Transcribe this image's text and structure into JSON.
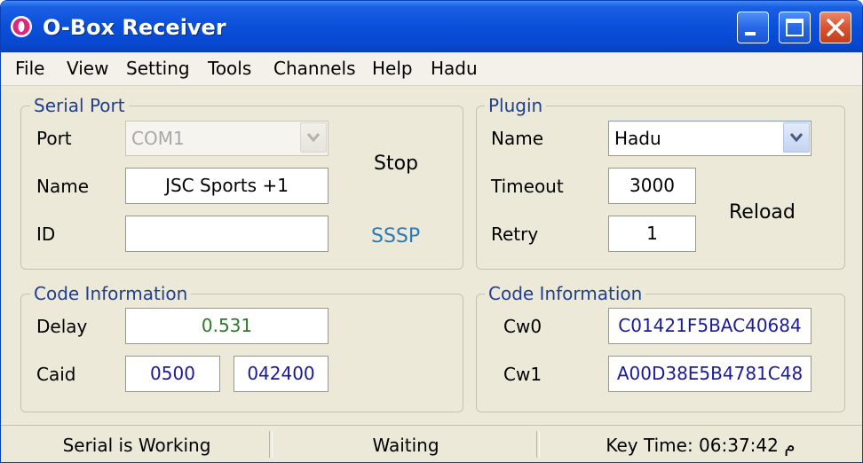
{
  "window": {
    "title": "O-Box Receiver",
    "icon": "obox-app-icon",
    "controls": {
      "minimize": "minimize-icon",
      "maximize": "maximize-icon",
      "close": "close-icon"
    }
  },
  "menu": [
    "File",
    "View",
    "Setting",
    "Tools",
    "Channels",
    "Help",
    "Hadu"
  ],
  "serial_port": {
    "legend": "Serial Port",
    "port_label": "Port",
    "port_value": "COM1",
    "name_label": "Name",
    "name_value": "JSC Sports +1",
    "id_label": "ID",
    "id_value": "",
    "stop_button": "Stop",
    "sssp_button": "SSSP"
  },
  "plugin": {
    "legend": "Plugin",
    "name_label": "Name",
    "name_value": "Hadu",
    "timeout_label": "Timeout",
    "timeout_value": "3000",
    "retry_label": "Retry",
    "retry_value": "1",
    "reload_button": "Reload"
  },
  "code_info_left": {
    "legend": "Code Information",
    "delay_label": "Delay",
    "delay_value": "0.531",
    "caid_label": "Caid",
    "caid_value": "0500",
    "provid_value": "042400"
  },
  "code_info_right": {
    "legend": "Code Information",
    "cw0_label": "Cw0",
    "cw0_value": "C01421F5BAC40684",
    "cw1_label": "Cw1",
    "cw1_value": "A00D38E5B4781C48"
  },
  "status": {
    "serial": "Serial is Working",
    "state": "Waiting",
    "key_time": "Key Time: 06:37:42 م"
  },
  "colors": {
    "titlebar": "#0a4fd9",
    "window_bg": "#ece9d8",
    "legend_text": "#1f3f8f",
    "value_blue": "#1a1a9a",
    "value_green": "#2a7a2a",
    "link_blue": "#2a7ab8",
    "close_button": "#d8532f"
  }
}
